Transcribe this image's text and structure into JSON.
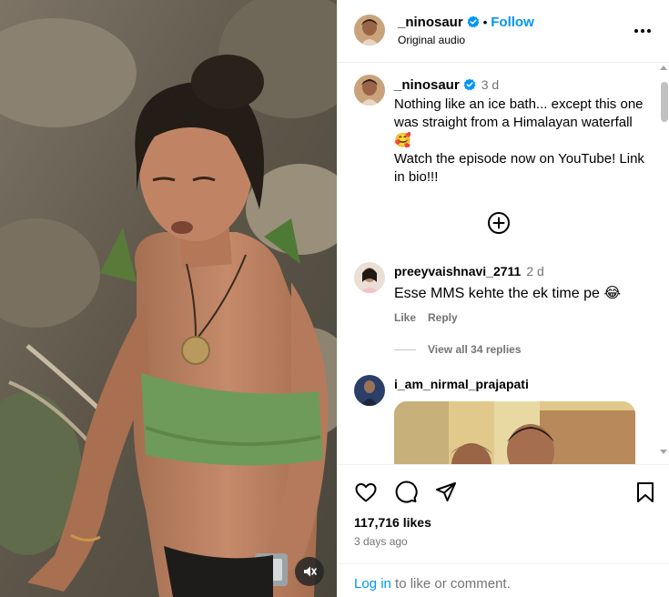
{
  "post": {
    "username": "_ninosaur",
    "follow_label": "Follow",
    "dot": "•",
    "audio": "Original audio"
  },
  "caption": {
    "username": "_ninosaur",
    "time": "3 d",
    "text": "Nothing like an ice bath... except this one was straight from a Himalayan waterfall 🥰\nWatch the episode now on YouTube! Link in bio!!!"
  },
  "comments": [
    {
      "username": "preeyvaishnavi_2711",
      "time": "2 d",
      "text": "Esse MMS kehte the ek time pe 😂",
      "like_label": "Like",
      "reply_label": "Reply",
      "view_replies": "View all 34 replies"
    },
    {
      "username": "i_am_nirmal_prajapati"
    }
  ],
  "stats": {
    "likes": "117,716 likes",
    "ago": "3 days ago"
  },
  "login": {
    "link": "Log in",
    "rest": " to like or comment."
  },
  "icons": {
    "verified": "verified-badge-icon",
    "more": "more-options-icon",
    "add": "add-circle-icon",
    "like": "heart-icon",
    "comment": "comment-bubble-icon",
    "share": "paper-plane-icon",
    "save": "bookmark-icon",
    "mute": "muted-speaker-icon"
  },
  "colors": {
    "link_blue": "#0095f6",
    "muted_text": "#737373",
    "border": "#efefef"
  }
}
